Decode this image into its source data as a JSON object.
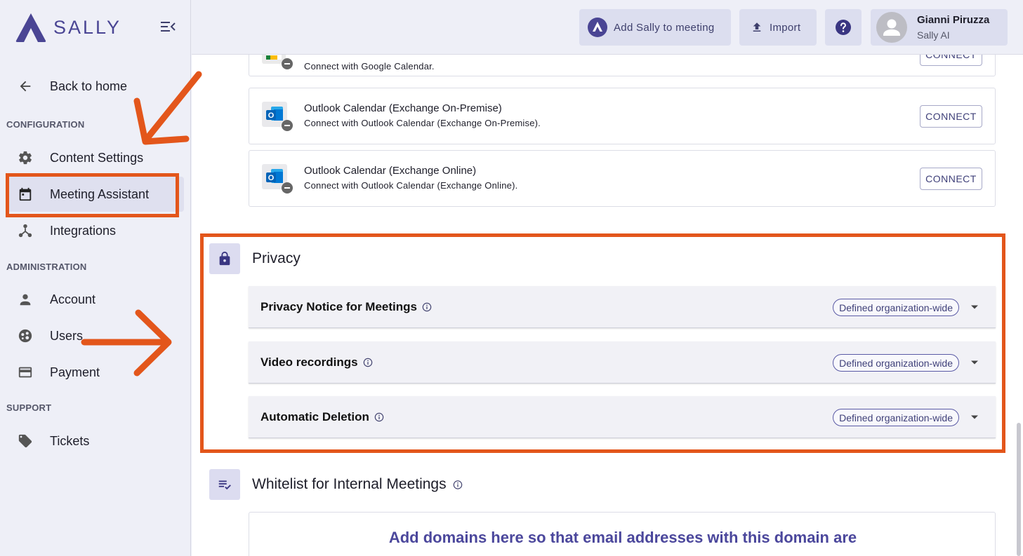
{
  "brand": {
    "name": "SALLY",
    "color": "#4a4594"
  },
  "sidebar": {
    "back": "Back to home",
    "sections": {
      "configuration": "CONFIGURATION",
      "administration": "ADMINISTRATION",
      "support": "SUPPORT"
    },
    "items": {
      "content_settings": "Content Settings",
      "meeting_assistant": "Meeting Assistant",
      "integrations": "Integrations",
      "account": "Account",
      "users": "Users",
      "payment": "Payment",
      "tickets": "Tickets"
    },
    "active": "Meeting Assistant"
  },
  "header": {
    "add_sally": "Add Sally to meeting",
    "import": "Import",
    "user": {
      "name": "Gianni Piruzza",
      "org": "Sally AI"
    }
  },
  "calendars": [
    {
      "title": "",
      "sub": "Connect with Google Calendar.",
      "button": "CONNECT"
    },
    {
      "title": "Outlook Calendar (Exchange On-Premise)",
      "sub": "Connect with Outlook Calendar (Exchange On-Premise).",
      "button": "CONNECT"
    },
    {
      "title": "Outlook Calendar (Exchange Online)",
      "sub": "Connect with Outlook Calendar (Exchange Online).",
      "button": "CONNECT"
    }
  ],
  "privacy": {
    "title": "Privacy",
    "items": [
      {
        "label": "Privacy Notice for Meetings",
        "badge": "Defined organization-wide"
      },
      {
        "label": "Video recordings",
        "badge": "Defined organization-wide"
      },
      {
        "label": "Automatic Deletion",
        "badge": "Defined organization-wide"
      }
    ]
  },
  "whitelist": {
    "title": "Whitelist for Internal Meetings",
    "description": "Add domains here so that email addresses with this domain are"
  },
  "colors": {
    "annotation": "#e3561b",
    "accent": "#4a4594"
  },
  "icons": [
    "logo-mark-icon",
    "collapse-menu-icon",
    "arrow-back-icon",
    "gear-icon",
    "calendar-icon",
    "integrations-icon",
    "person-icon",
    "users-icon",
    "credit-card-icon",
    "tag-icon",
    "upload-icon",
    "help-icon",
    "avatar-icon",
    "google-calendar-icon",
    "outlook-icon",
    "lock-icon",
    "info-icon",
    "chevron-down-icon",
    "checklist-icon",
    "annotation-arrow-icon"
  ]
}
